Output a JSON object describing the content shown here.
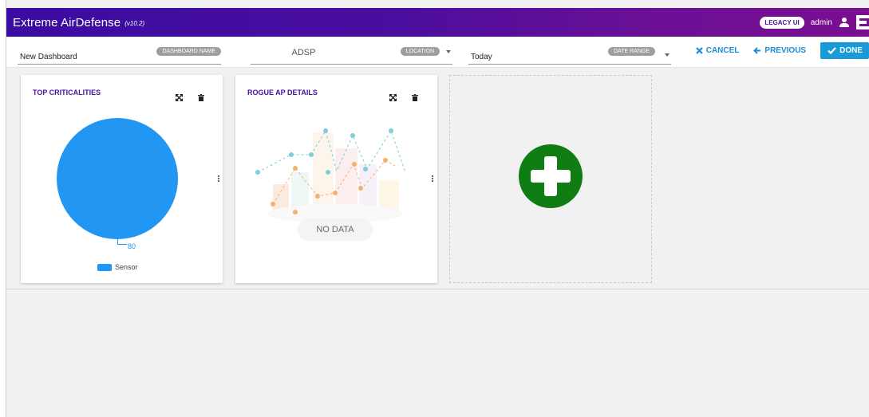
{
  "header": {
    "title": "Extreme AirDefense",
    "version": "(v10.2)",
    "legacy_button": "LEGACY UI",
    "user": "admin",
    "icons": [
      "user-icon",
      "extreme-logo-icon"
    ]
  },
  "toolbar": {
    "dashboard_name": {
      "value": "New Dashboard",
      "chip": "DASHBOARD NAME"
    },
    "location": {
      "value": "ADSP",
      "chip": "LOCATION"
    },
    "date_range": {
      "value": "Today",
      "chip": "DATE RANGE"
    },
    "cancel_label": "CANCEL",
    "previous_label": "PREVIOUS",
    "done_label": "DONE"
  },
  "widgets": [
    {
      "title": "TOP CRITICALITIES",
      "chart_data": {
        "type": "pie",
        "categories": [
          "Sensor"
        ],
        "values": [
          80
        ],
        "data_labels": [
          "80"
        ],
        "legend": [
          "Sensor"
        ],
        "legend_position": "bottom",
        "colors": [
          "#2196f3"
        ]
      }
    },
    {
      "title": "ROGUE AP DETAILS",
      "empty_label": "NO DATA"
    }
  ],
  "colors": {
    "header_gradient_start": "#3a0ca3",
    "header_gradient_end": "#7a0f8f",
    "accent": "#1a8cd8",
    "title_purple": "#4b0e9e",
    "pie_blue": "#2196f3",
    "add_green": "#0f7d14"
  }
}
